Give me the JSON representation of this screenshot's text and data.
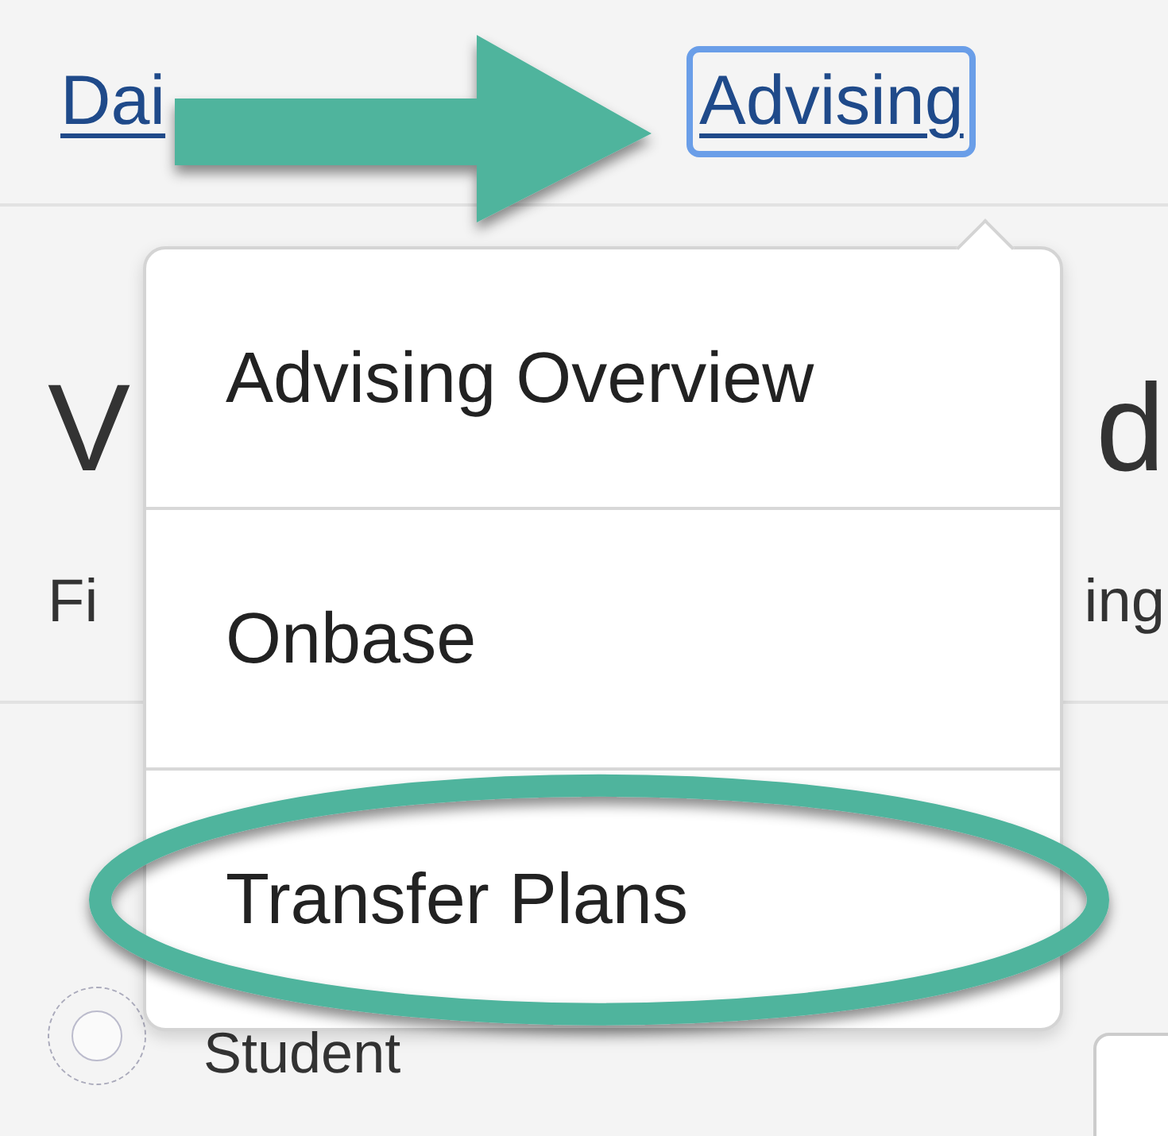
{
  "nav": {
    "links": [
      {
        "label": "Dai",
        "selected": false
      },
      {
        "label": "Advising",
        "selected": true
      }
    ]
  },
  "page": {
    "heading_start": "V",
    "heading_end": "d",
    "subtitle_start": "Fi",
    "subtitle_end": "ing",
    "options": [
      {
        "label": "Student",
        "selected": false
      }
    ]
  },
  "dropdown": {
    "items": [
      {
        "label": "Advising Overview",
        "circled": false
      },
      {
        "label": "Onbase",
        "circled": false
      },
      {
        "label": "Transfer Plans",
        "circled": true
      }
    ]
  }
}
